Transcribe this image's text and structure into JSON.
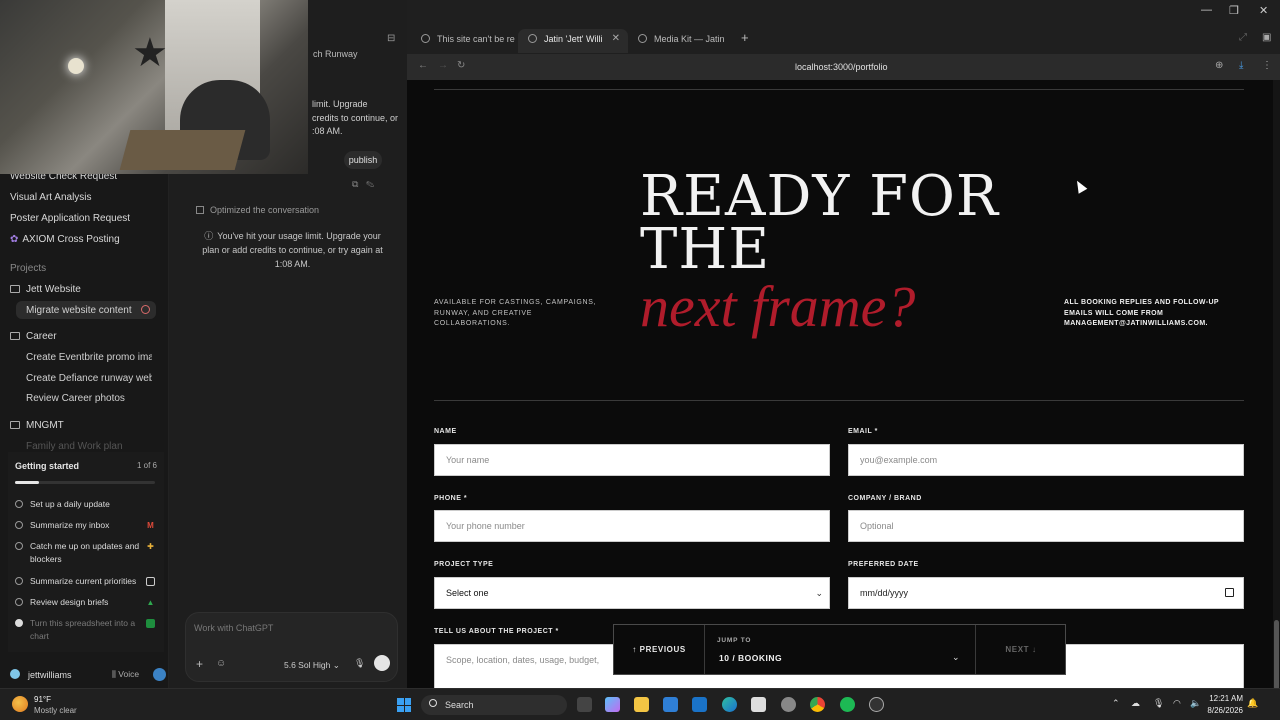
{
  "colors": {
    "accent_red": "#b01c2b",
    "site_bg": "#0b0b0b",
    "sidebar_bg": "#181818"
  },
  "sidebar": {
    "top_partial_label": "ch Runway",
    "items": [
      {
        "label": "Website Check Request"
      },
      {
        "label": "Visual Art Analysis"
      },
      {
        "label": "Poster Application Request"
      },
      {
        "label": "AXIOM Cross Posting"
      }
    ],
    "projects_heading": "Projects",
    "projects": [
      {
        "label": "Jett Website",
        "children": [
          "Migrate website content"
        ]
      },
      {
        "label": "Career",
        "children": [
          "Create Eventbrite promo imag",
          "Create Defiance runway websi",
          "Review Career photos"
        ]
      },
      {
        "label": "MNGMT",
        "children": [
          "Family and Work plan"
        ]
      }
    ],
    "getting_started": {
      "title": "Getting started",
      "count": "1 of 6",
      "progress": 0.17,
      "tasks": [
        {
          "label": "Set up a daily update",
          "done": false,
          "app_icon": ""
        },
        {
          "label": "Summarize my inbox",
          "done": false,
          "app_icon": "gmail-icon"
        },
        {
          "label": "Catch me up on updates and blockers",
          "done": false,
          "app_icon": "slack-icon"
        },
        {
          "label": "Summarize current priorities",
          "done": false,
          "app_icon": "calendar-icon"
        },
        {
          "label": "Review design briefs",
          "done": false,
          "app_icon": "drive-icon"
        },
        {
          "label": "Turn this spreadsheet into a chart",
          "done": true,
          "app_icon": "sheets-icon"
        }
      ]
    },
    "user": {
      "name": "jettwilliams",
      "voice_label": "Voice"
    }
  },
  "chat": {
    "assistant_partial": "limit. Upgrade\ncredits to continue, or\n:08 AM.",
    "publish_label": "publish",
    "optimized_label": "Optimized the conversation",
    "usage_limit": "You've hit your usage limit. Upgrade your plan or add credits to continue, or try again at 1:08 AM.",
    "composer_placeholder": "Work with ChatGPT",
    "model_label": "5.6 Sol",
    "reasoning_label": "High"
  },
  "browser": {
    "tabs": [
      {
        "label": "This site can't be re"
      },
      {
        "label": "Jatin 'Jett' Willi"
      },
      {
        "label": "Media Kit — Jatin"
      }
    ],
    "url": "localhost:3000/portfolio"
  },
  "page": {
    "hero_line1": "READY FOR",
    "hero_line2": "THE",
    "hero_accent": "next frame?",
    "left_copy": "AVAILABLE FOR CASTINGS, CAMPAIGNS, RUNWAY, AND CREATIVE COLLABORATIONS.",
    "right_copy": "ALL BOOKING REPLIES AND FOLLOW-UP EMAILS WILL COME FROM MANAGEMENT@JATINWILLIAMS.COM.",
    "form": {
      "name_label": "NAME",
      "name_placeholder": "Your name",
      "email_label": "EMAIL *",
      "email_placeholder": "you@example.com",
      "phone_label": "PHONE *",
      "phone_placeholder": "Your phone number",
      "company_label": "COMPANY / BRAND",
      "company_placeholder": "Optional",
      "project_type_label": "PROJECT TYPE",
      "project_type_value": "Select one",
      "date_label": "PREFERRED DATE",
      "date_placeholder": "mm/dd/yyyy",
      "project_label": "TELL US ABOUT THE PROJECT *",
      "project_placeholder": "Scope, location, dates, usage, budget,"
    },
    "nav": {
      "prev_label": "PREVIOUS",
      "jump_label": "JUMP TO",
      "jump_value": "10 / BOOKING",
      "next_label": "NEXT"
    }
  },
  "taskbar": {
    "weather_temp": "91°F",
    "weather_desc": "Mostly clear",
    "search_label": "Search",
    "time": "12:21 AM",
    "date": "8/26/2026"
  }
}
